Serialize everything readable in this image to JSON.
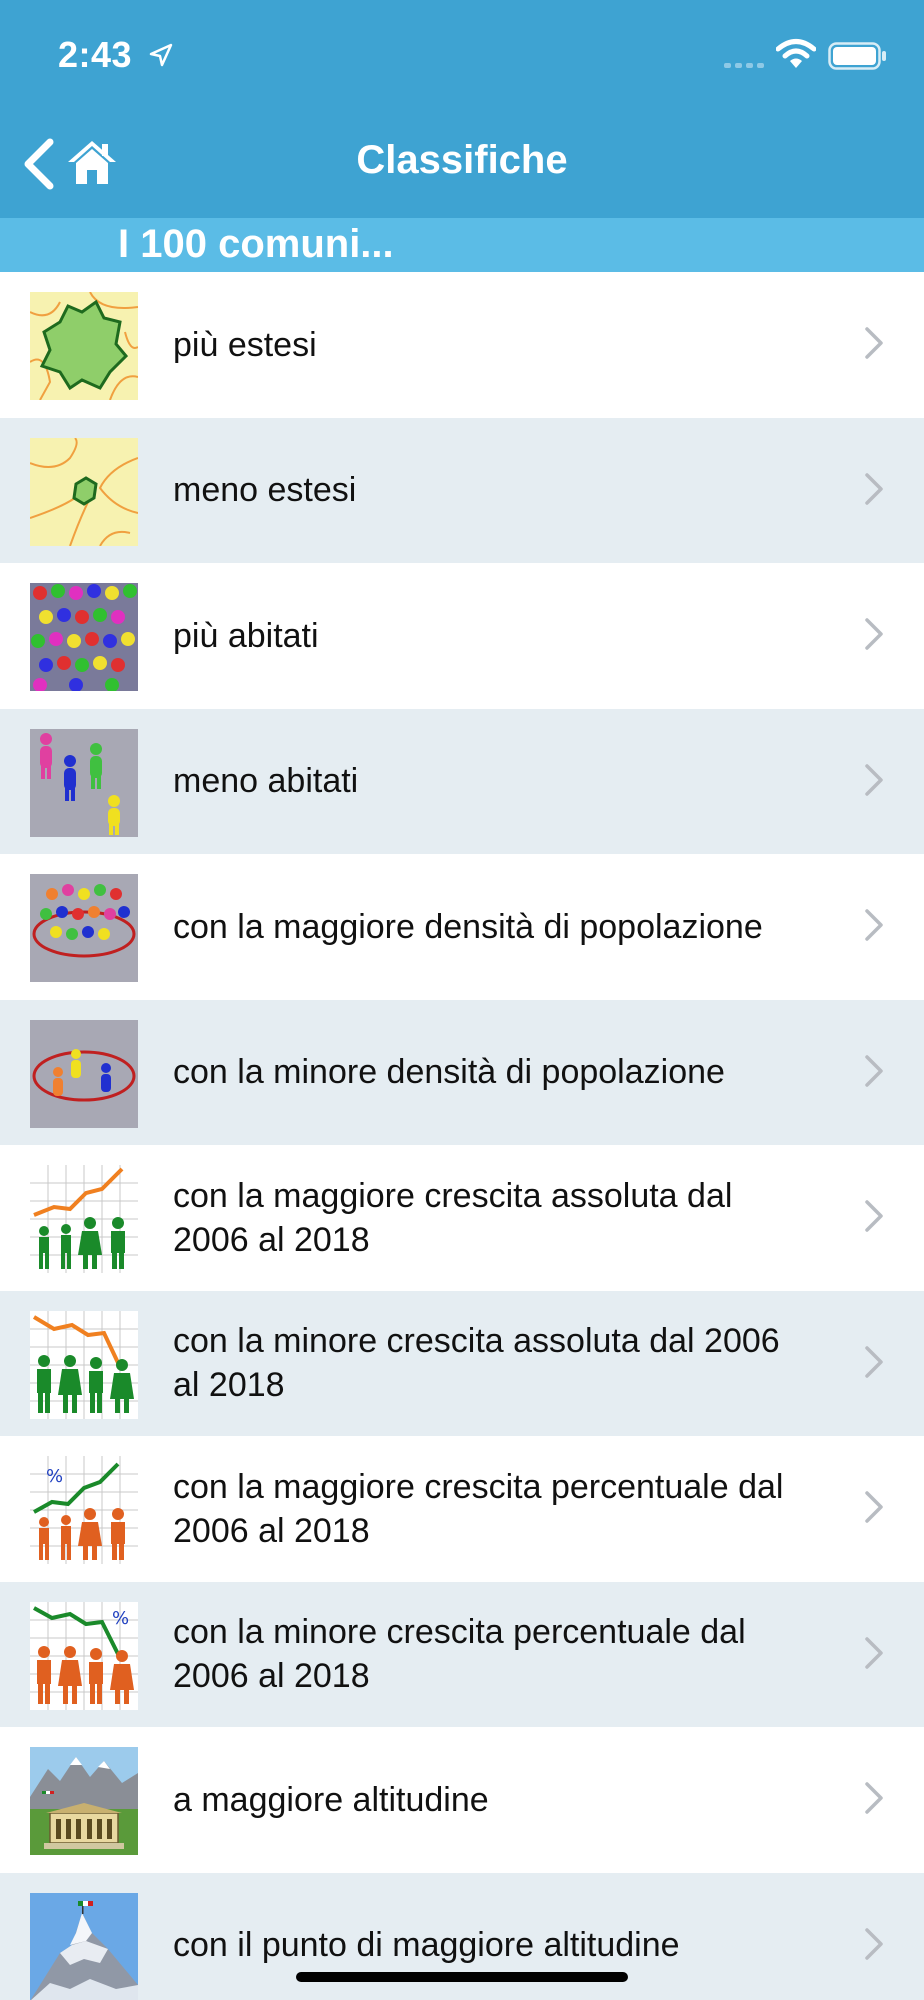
{
  "status_bar": {
    "time": "2:43"
  },
  "nav": {
    "title": "Classifiche"
  },
  "section": {
    "title": "I 100 comuni..."
  },
  "items": [
    {
      "label": "più estesi",
      "icon": "map-large-area-icon"
    },
    {
      "label": "meno estesi",
      "icon": "map-small-area-icon"
    },
    {
      "label": "più abitati",
      "icon": "crowd-icon"
    },
    {
      "label": "meno abitati",
      "icon": "few-people-icon"
    },
    {
      "label": "con la maggiore densità di popolazione",
      "icon": "dense-crowd-icon"
    },
    {
      "label": "con la minore densità di popolazione",
      "icon": "sparse-crowd-icon"
    },
    {
      "label": "con la maggiore crescita assoluta dal 2006 al 2018",
      "icon": "growth-chart-icon"
    },
    {
      "label": "con la minore crescita assoluta dal 2006 al 2018",
      "icon": "decline-chart-icon"
    },
    {
      "label": "con la maggiore crescita percentuale dal 2006 al 2018",
      "icon": "percent-growth-icon"
    },
    {
      "label": "con la minore crescita percentuale dal 2006 al 2018",
      "icon": "percent-decline-icon"
    },
    {
      "label": "a maggiore altitudine",
      "icon": "mountain-townhall-icon"
    },
    {
      "label": "con il punto di maggiore altitudine",
      "icon": "mountain-peak-icon"
    }
  ],
  "colors": {
    "nav_bg": "#3ea3d2",
    "section_bg": "#5bbce6",
    "row_alt_bg": "#e5edf2"
  }
}
